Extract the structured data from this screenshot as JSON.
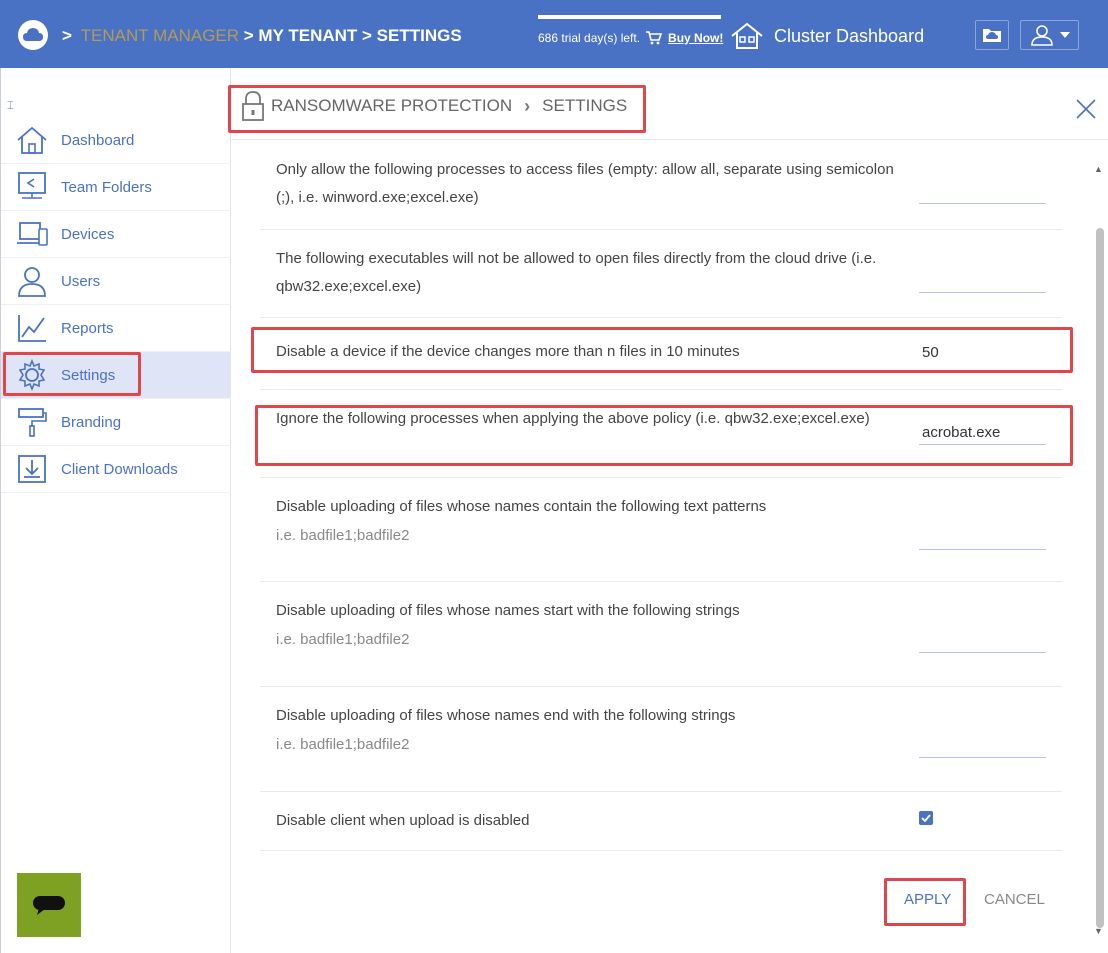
{
  "topbar": {
    "crumb_prefix": ">",
    "tenant_manager": "TENANT MANAGER",
    "my_tenant": "> MY TENANT",
    "settings": "> SETTINGS",
    "trial_text": "686 trial day(s) left.",
    "buy_now": "Buy Now!",
    "cluster_dashboard": "Cluster Dashboard"
  },
  "sidebar": {
    "collapse_glyph": "⌶",
    "items": [
      {
        "label": "Dashboard",
        "icon": "home-icon"
      },
      {
        "label": "Team Folders",
        "icon": "team-folders-icon"
      },
      {
        "label": "Devices",
        "icon": "devices-icon"
      },
      {
        "label": "Users",
        "icon": "users-icon"
      },
      {
        "label": "Reports",
        "icon": "reports-icon"
      },
      {
        "label": "Settings",
        "icon": "gear-icon",
        "active": true
      },
      {
        "label": "Branding",
        "icon": "paint-roller-icon"
      },
      {
        "label": "Client Downloads",
        "icon": "download-icon"
      }
    ]
  },
  "panel": {
    "title": "RANSOMWARE PROTECTION",
    "subtitle": "SETTINGS"
  },
  "settings": {
    "rows": [
      {
        "label": "Only allow the following processes to access files (empty: allow all, separate using semicolon (;), i.e. winword.exe;excel.exe)",
        "value": ""
      },
      {
        "label": "The following executables will not be allowed to open files directly from the cloud drive (i.e. qbw32.exe;excel.exe)",
        "value": ""
      },
      {
        "label": "Disable a device if the device changes more than n files in 10 minutes",
        "value": "50"
      },
      {
        "label": "Ignore the following processes when applying the above policy (i.e. qbw32.exe;excel.exe)",
        "value": "acrobat.exe"
      },
      {
        "label": "Disable uploading of files whose names contain the following text patterns",
        "hint": "i.e. badfile1;badfile2",
        "value": ""
      },
      {
        "label": "Disable uploading of files whose names start with the following strings",
        "hint": "i.e. badfile1;badfile2",
        "value": ""
      },
      {
        "label": "Disable uploading of files whose names end with the following strings",
        "hint": "i.e. badfile1;badfile2",
        "value": ""
      },
      {
        "label": "Disable client when upload is disabled",
        "checked": true
      }
    ]
  },
  "actions": {
    "apply": "APPLY",
    "cancel": "CANCEL"
  },
  "colors": {
    "topbar": "#4a72c4",
    "accent": "#4a72c4",
    "highlight": "#e0474c",
    "chat": "#7ea124"
  }
}
